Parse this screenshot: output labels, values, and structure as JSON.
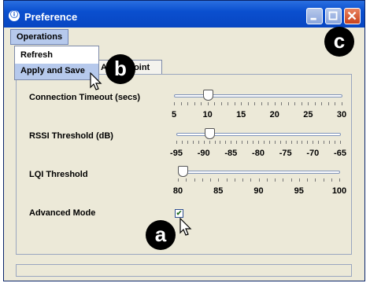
{
  "window": {
    "title": "Preference",
    "app_icon_glyph": "ⓘ",
    "controls": {
      "minimize": "minimize-icon",
      "maximize": "maximize-icon",
      "close": "close-icon"
    }
  },
  "menubar": {
    "operations_label": "Operations"
  },
  "operations_menu": {
    "items": [
      {
        "label": "Refresh"
      },
      {
        "label": "Apply and Save",
        "highlighted": true
      }
    ]
  },
  "tab": {
    "label_partial": "Ac",
    "label_end": "oint"
  },
  "settings": {
    "connection_timeout": {
      "label": "Connection Timeout (secs)",
      "ticks": [
        "5",
        "10",
        "15",
        "20",
        "25",
        "30"
      ],
      "value": 10
    },
    "rssi_threshold": {
      "label": "RSSI Threshold (dB)",
      "ticks": [
        "-95",
        "-90",
        "-85",
        "-80",
        "-75",
        "-70",
        "-65"
      ],
      "value": -89
    },
    "lqi_threshold": {
      "label": "LQI Threshold",
      "ticks": [
        "80",
        "85",
        "90",
        "95",
        "100"
      ],
      "value": 80
    },
    "advanced_mode": {
      "label": "Advanced Mode",
      "checked": true,
      "check_glyph": "✔"
    }
  },
  "annotations": {
    "a": "a",
    "b": "b",
    "c": "c"
  },
  "colors": {
    "titlebar": "#0a4fcf",
    "highlight": "#b6c9ec",
    "close_button": "#c9421c"
  }
}
